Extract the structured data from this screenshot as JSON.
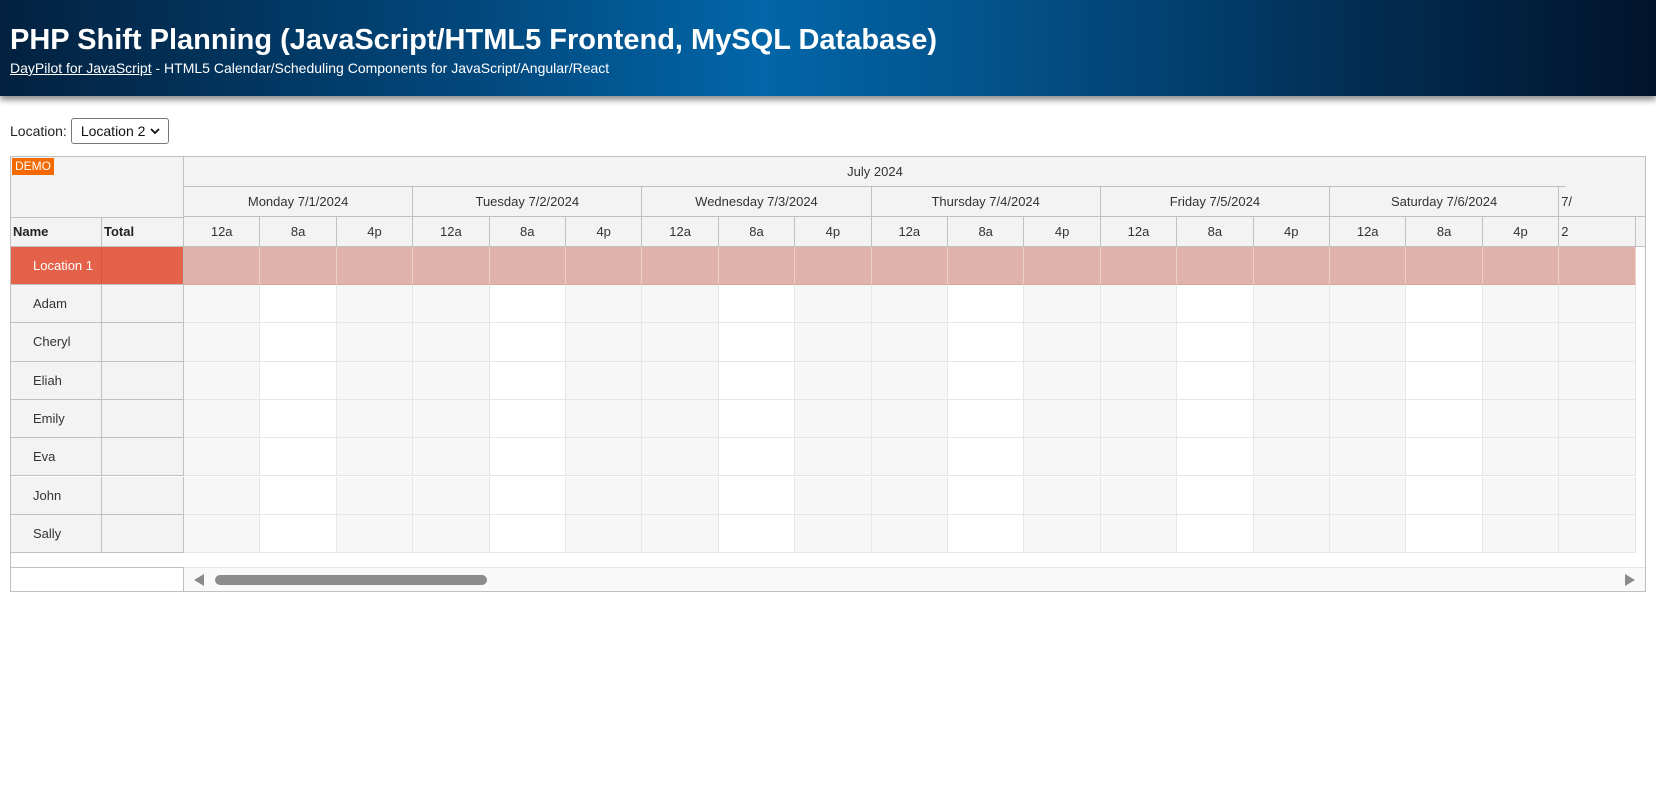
{
  "header": {
    "title": "PHP Shift Planning (JavaScript/HTML5 Frontend, MySQL Database)",
    "link_text": "DayPilot for JavaScript",
    "subtitle_rest": " - HTML5 Calendar/Scheduling Components for JavaScript/Angular/React"
  },
  "toolbar": {
    "location_label": "Location:",
    "location_selected": "Location 2"
  },
  "scheduler": {
    "demo_badge": "DEMO",
    "month_label": "July 2024",
    "columns": {
      "name": "Name",
      "total": "Total"
    },
    "days": [
      "Monday 7/1/2024",
      "Tuesday 7/2/2024",
      "Wednesday 7/3/2024",
      "Thursday 7/4/2024",
      "Friday 7/5/2024",
      "Saturday 7/6/2024",
      "7/"
    ],
    "hours": [
      "12a",
      "8a",
      "4p"
    ],
    "hours_partial": "2",
    "rows": [
      {
        "name": "Location 1",
        "total": "",
        "type": "location"
      },
      {
        "name": "Adam",
        "total": "",
        "type": "person"
      },
      {
        "name": "Cheryl",
        "total": "",
        "type": "person"
      },
      {
        "name": "Eliah",
        "total": "",
        "type": "person"
      },
      {
        "name": "Emily",
        "total": "",
        "type": "person"
      },
      {
        "name": "Eva",
        "total": "",
        "type": "person"
      },
      {
        "name": "John",
        "total": "",
        "type": "person"
      },
      {
        "name": "Sally",
        "total": "",
        "type": "person"
      }
    ]
  },
  "colors": {
    "location_row_header": "#e4624a",
    "location_row_cells": "#e0b3aa",
    "demo_badge": "#f46a00"
  }
}
